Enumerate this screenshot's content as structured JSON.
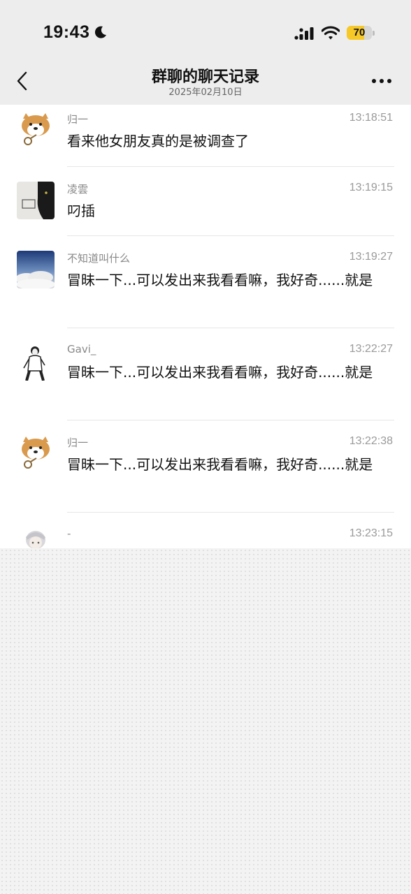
{
  "status_bar": {
    "time": "19:43",
    "battery_level": "70",
    "battery_fraction": 0.7,
    "battery_color": "#f7c928",
    "icons": [
      "moon-icon",
      "signal-icon",
      "wifi-icon",
      "battery-icon"
    ]
  },
  "nav": {
    "title": "群聊的聊天记录",
    "subtitle": "2025年02月10日",
    "back_icon": "chevron-left-icon",
    "more_icon": "more-dots-icon"
  },
  "messages": [
    {
      "sender": "归一",
      "time": "13:18:51",
      "text": "看来他女朋友真的是被调查了",
      "avatar": "shiba-dog-avatar"
    },
    {
      "sender": "凌雲",
      "time": "13:19:15",
      "text": "叼插",
      "avatar": "black-cat-avatar"
    },
    {
      "sender": "不知道叫什么",
      "time": "13:19:27",
      "text": "冒昧一下...可以发出来我看看嘛，我好奇......就是",
      "avatar": "sky-clouds-avatar"
    },
    {
      "sender": "Gavi_",
      "time": "13:22:27",
      "text": "冒昧一下...可以发出来我看看嘛，我好奇......就是",
      "avatar": "person-sketch-avatar"
    },
    {
      "sender": "归一",
      "time": "13:22:38",
      "text": "冒昧一下...可以发出来我看看嘛，我好奇......就是",
      "avatar": "shiba-dog-avatar"
    },
    {
      "sender": "-",
      "time": "13:23:15",
      "text": "",
      "avatar": "anime-character-avatar"
    }
  ]
}
